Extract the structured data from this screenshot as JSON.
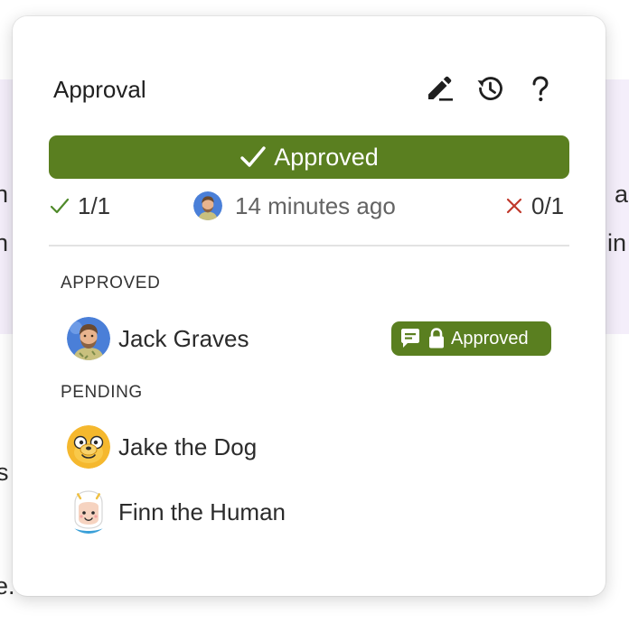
{
  "background": {
    "fragments": [
      "n",
      "n",
      "a",
      "in",
      "s",
      "e."
    ]
  },
  "popover": {
    "title": "Approval",
    "toolbar": {
      "edit_icon": "pencil-icon",
      "history_icon": "history-icon",
      "help_icon": "help-icon"
    },
    "status": {
      "label": "Approved",
      "icon": "checkmark-icon",
      "color": "#5a7f20"
    },
    "summary": {
      "approved_count": "1/1",
      "last_update": "14 minutes ago",
      "rejected_count": "0/1"
    },
    "sections": {
      "approved_heading": "APPROVED",
      "pending_heading": "PENDING"
    },
    "approved_reviewers": [
      {
        "name": "Jack Graves",
        "badge": "Approved"
      }
    ],
    "pending_reviewers": [
      {
        "name": "Jake the Dog"
      },
      {
        "name": "Finn the Human"
      }
    ],
    "colors": {
      "approve_green": "#5a7f20",
      "check_green": "#4f8a2a",
      "reject_red": "#c0392b"
    }
  }
}
